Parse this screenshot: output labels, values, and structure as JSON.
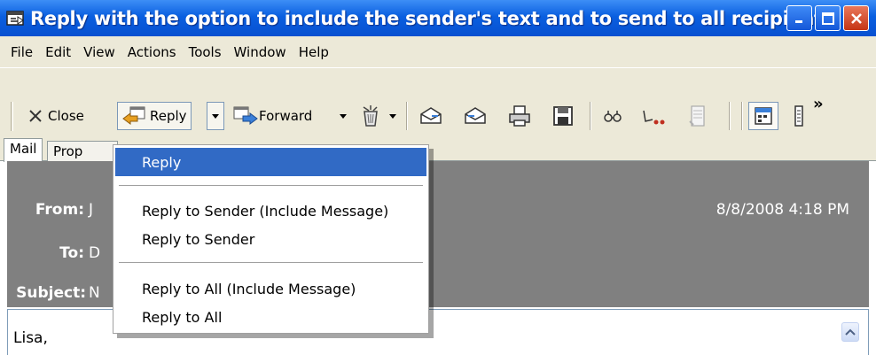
{
  "window": {
    "title": "Reply with the option to include the sender's text and to send to all recipients",
    "title_bar_color": "#0a5fe0"
  },
  "menubar": [
    "File",
    "Edit",
    "View",
    "Actions",
    "Tools",
    "Window",
    "Help"
  ],
  "toolbar": {
    "close_label": "Close",
    "reply_label": "Reply",
    "forward_label": "Forward",
    "overflow_label": "»"
  },
  "tabs": [
    "Mail",
    "Prop"
  ],
  "header": {
    "from_label": "From:",
    "from_value": "J",
    "to_label": "To:",
    "to_value": "D",
    "subject_label": "Subject:",
    "subject_value": "N",
    "date": "8/8/2008 4:18 PM",
    "background_color": "#808080"
  },
  "body": {
    "text": "Lisa,"
  },
  "reply_menu": {
    "items": [
      {
        "label": "Reply",
        "selected": true
      },
      {
        "label": "Reply to Sender (Include Message)",
        "selected": false
      },
      {
        "label": "Reply to Sender",
        "selected": false
      },
      {
        "label": "Reply to All (Include Message)",
        "selected": false
      },
      {
        "label": "Reply to All",
        "selected": false
      }
    ],
    "highlight_color": "#316ac5"
  }
}
